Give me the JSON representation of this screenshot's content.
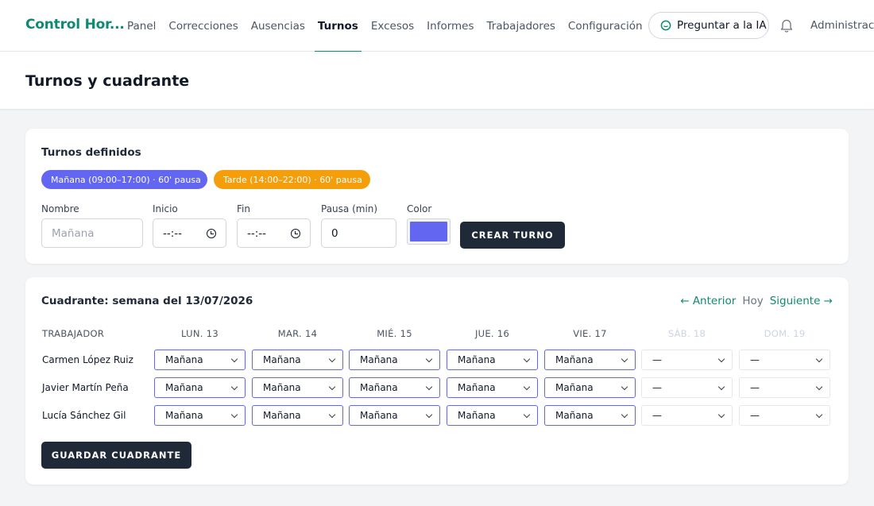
{
  "app": {
    "brand": "Control Hor..."
  },
  "nav": {
    "items": [
      {
        "label": "Panel"
      },
      {
        "label": "Correcciones"
      },
      {
        "label": "Ausencias"
      },
      {
        "label": "Turnos",
        "active": true
      },
      {
        "label": "Excesos"
      },
      {
        "label": "Informes"
      },
      {
        "label": "Trabajadores"
      },
      {
        "label": "Configuración",
        "dropdown": true
      }
    ],
    "ia_button": "Preguntar a la IA",
    "user": "Administraci"
  },
  "page": {
    "title": "Turnos y cuadrante"
  },
  "shifts": {
    "title": "Turnos definidos",
    "chips": [
      {
        "label": "Mañana (09:00–17:00) · 60' pausa",
        "color": "#6366f1"
      },
      {
        "label": "Tarde (14:00–22:00) · 60' pausa",
        "color": "#f59e0b"
      }
    ],
    "form": {
      "name_label": "Nombre",
      "name_placeholder": "Mañana",
      "start_label": "Inicio",
      "start_value": "--:--",
      "end_label": "Fin",
      "end_value": "--:--",
      "break_label": "Pausa (min)",
      "break_value": "0",
      "color_label": "Color",
      "color_value": "#6366f1",
      "create_button": "CREAR TURNO"
    }
  },
  "schedule": {
    "title": "Cuadrante: semana del 13/07/2026",
    "nav": {
      "prev": "← Anterior",
      "today": "Hoy",
      "next": "Siguiente →"
    },
    "worker_header": "TRABAJADOR",
    "days": [
      {
        "label": "LUN. 13",
        "weekend": false
      },
      {
        "label": "MAR. 14",
        "weekend": false
      },
      {
        "label": "MIÉ. 15",
        "weekend": false
      },
      {
        "label": "JUE. 16",
        "weekend": false
      },
      {
        "label": "VIE. 17",
        "weekend": false
      },
      {
        "label": "SÁB. 18",
        "weekend": true
      },
      {
        "label": "DOM. 19",
        "weekend": true
      }
    ],
    "rows": [
      {
        "worker": "Carmen López Ruiz",
        "shifts": [
          "Mañana",
          "Mañana",
          "Mañana",
          "Mañana",
          "Mañana",
          "—",
          "—"
        ]
      },
      {
        "worker": "Javier Martín Peña",
        "shifts": [
          "Mañana",
          "Mañana",
          "Mañana",
          "Mañana",
          "Mañana",
          "—",
          "—"
        ]
      },
      {
        "worker": "Lucía Sánchez Gil",
        "shifts": [
          "Mañana",
          "Mañana",
          "Mañana",
          "Mañana",
          "Mañana",
          "—",
          "—"
        ]
      }
    ],
    "save_button": "GUARDAR CUADRANTE"
  },
  "colors": {
    "accent": "#0f8a72",
    "dark_button": "#1f2937",
    "select_border": "#6366f1"
  }
}
